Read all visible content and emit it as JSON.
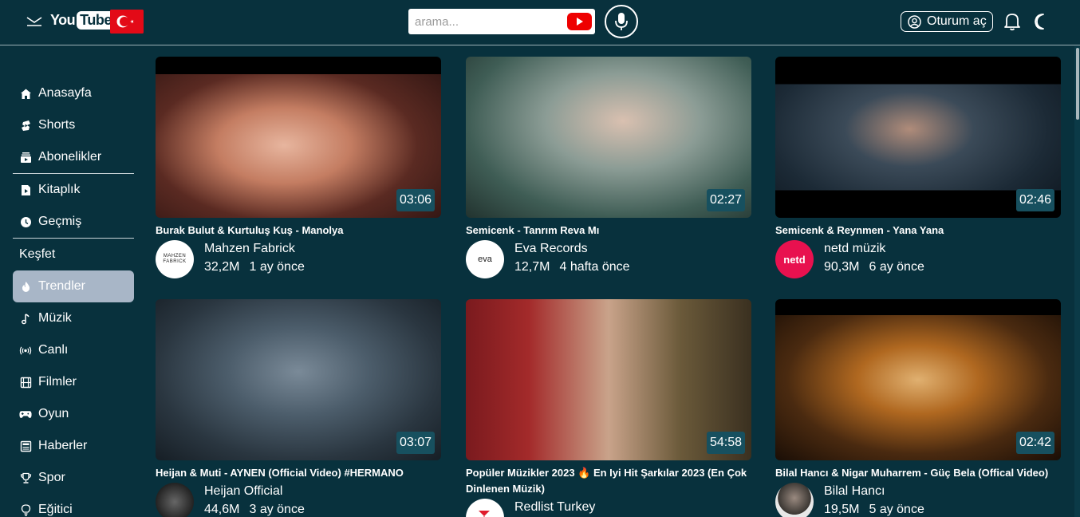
{
  "header": {
    "logo_you": "You",
    "logo_tube": "Tube",
    "search_placeholder": "arama...",
    "login_label": "Oturum aç"
  },
  "sidebar": {
    "items_top": [
      {
        "label": "Anasayfa",
        "icon": "home-icon"
      },
      {
        "label": "Shorts",
        "icon": "shorts-icon"
      },
      {
        "label": "Abonelikler",
        "icon": "subscriptions-icon"
      }
    ],
    "items_mid": [
      {
        "label": "Kitaplık",
        "icon": "library-icon"
      },
      {
        "label": "Geçmiş",
        "icon": "history-icon"
      }
    ],
    "explore_heading": "Keşfet",
    "items_explore": [
      {
        "label": "Trendler",
        "icon": "fire-icon",
        "active": true
      },
      {
        "label": "Müzik",
        "icon": "music-icon"
      },
      {
        "label": "Canlı",
        "icon": "live-icon"
      },
      {
        "label": "Filmler",
        "icon": "film-icon"
      },
      {
        "label": "Oyun",
        "icon": "gamepad-icon"
      },
      {
        "label": "Haberler",
        "icon": "news-icon"
      },
      {
        "label": "Spor",
        "icon": "trophy-icon"
      },
      {
        "label": "Eğitici",
        "icon": "lightbulb-icon"
      }
    ]
  },
  "videos": [
    {
      "title": "Burak Bulut & Kurtuluş Kuş - Manolya",
      "channel": "Mahzen Fabrick",
      "views": "32,2M",
      "age": "1 ay önce",
      "duration": "03:06",
      "avatar_text": "MAHZEN FABRICK"
    },
    {
      "title": "Semicenk - Tanrım Reva Mı",
      "channel": "Eva Records",
      "views": "12,7M",
      "age": "4 hafta önce",
      "duration": "02:27",
      "avatar_text": "eva"
    },
    {
      "title": "Semicenk & Reynmen - Yana Yana",
      "channel": "netd müzik",
      "views": "90,3M",
      "age": "6 ay önce",
      "duration": "02:46",
      "avatar_text": "netd"
    },
    {
      "title": "Heijan & Muti - AYNEN (Official Video) #HERMANO",
      "channel": "Heijan Official",
      "views": "44,6M",
      "age": "3 ay önce",
      "duration": "03:07",
      "avatar_text": ""
    },
    {
      "title": "Popüler Müzikler 2023 🔥 En Iyi Hit Şarkılar 2023 (En Çok Dinlenen Müzik)",
      "channel": "Redlist Turkey",
      "views": "",
      "age": "",
      "duration": "54:58",
      "avatar_text": ""
    },
    {
      "title": "Bilal Hancı & Nigar Muharrem - Güç Bela (Offical Video)",
      "channel": "Bilal Hancı",
      "views": "19,5M",
      "age": "5 ay önce",
      "duration": "02:42",
      "avatar_text": ""
    }
  ]
}
